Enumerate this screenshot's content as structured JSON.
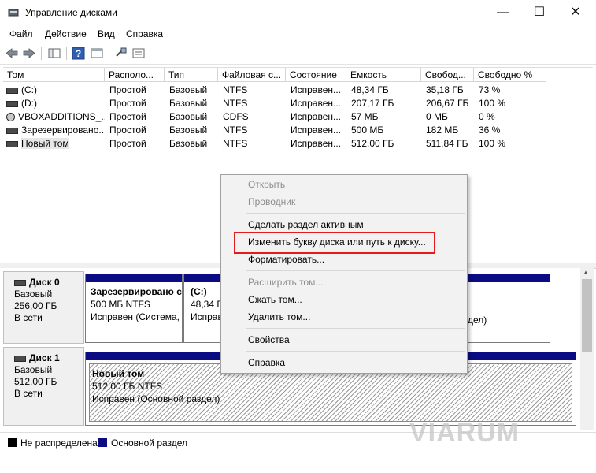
{
  "window": {
    "title": "Управление дисками"
  },
  "menu": [
    "Файл",
    "Действие",
    "Вид",
    "Справка"
  ],
  "columns": [
    "Том",
    "Располо...",
    "Тип",
    "Файловая с...",
    "Состояние",
    "Емкость",
    "Свобод...",
    "Свободно %"
  ],
  "volumes": [
    {
      "name": "(C:)",
      "layout": "Простой",
      "type": "Базовый",
      "fs": "NTFS",
      "status": "Исправен...",
      "capacity": "48,34 ГБ",
      "free": "35,18 ГБ",
      "pct": "73 %"
    },
    {
      "name": "(D:)",
      "layout": "Простой",
      "type": "Базовый",
      "fs": "NTFS",
      "status": "Исправен...",
      "capacity": "207,17 ГБ",
      "free": "206,67 ГБ",
      "pct": "100 %"
    },
    {
      "name": "VBOXADDITIONS_...",
      "layout": "Простой",
      "type": "Базовый",
      "fs": "CDFS",
      "status": "Исправен...",
      "capacity": "57 МБ",
      "free": "0 МБ",
      "pct": "0 %"
    },
    {
      "name": "Зарезервировано...",
      "layout": "Простой",
      "type": "Базовый",
      "fs": "NTFS",
      "status": "Исправен...",
      "capacity": "500 МБ",
      "free": "182 МБ",
      "pct": "36 %"
    },
    {
      "name": "Новый том",
      "layout": "Простой",
      "type": "Базовый",
      "fs": "NTFS",
      "status": "Исправен...",
      "capacity": "512,00 ГБ",
      "free": "511,84 ГБ",
      "pct": "100 %"
    }
  ],
  "disks": [
    {
      "name": "Диск 0",
      "type": "Базовый",
      "size": "256,00 ГБ",
      "state": "В сети"
    },
    {
      "name": "Диск 1",
      "type": "Базовый",
      "size": "512,00 ГБ",
      "state": "В сети"
    }
  ],
  "partitions": {
    "reserved": {
      "title": "Зарезервировано с",
      "size": "500 МБ NTFS",
      "status": "Исправен (Система,"
    },
    "c": {
      "title": "(C:)",
      "size": "48,34 ГБ",
      "status": "Исправ"
    },
    "d_tail": {
      "status": "дел)"
    },
    "new": {
      "title": "Новый том",
      "size": "512,00 ГБ NTFS",
      "status": "Исправен (Основной раздел)"
    }
  },
  "context_menu": [
    {
      "label": "Открыть",
      "enabled": false
    },
    {
      "label": "Проводник",
      "enabled": false
    },
    {
      "label": "Сделать раздел активным",
      "enabled": true
    },
    {
      "label": "Изменить букву диска или путь к диску...",
      "enabled": true,
      "highlighted": true
    },
    {
      "label": "Форматировать...",
      "enabled": true
    },
    {
      "label": "Расширить том...",
      "enabled": false
    },
    {
      "label": "Сжать том...",
      "enabled": true
    },
    {
      "label": "Удалить том...",
      "enabled": true
    },
    {
      "label": "Свойства",
      "enabled": true
    },
    {
      "label": "Справка",
      "enabled": true
    }
  ],
  "legend": [
    {
      "label": "Не распределена",
      "color": "#000000"
    },
    {
      "label": "Основной раздел",
      "color": "#0b0b83"
    }
  ],
  "watermark": "VIARUM",
  "colors": {
    "primary_partition": "#0b0b83",
    "highlight_border": "#e21b1b"
  }
}
